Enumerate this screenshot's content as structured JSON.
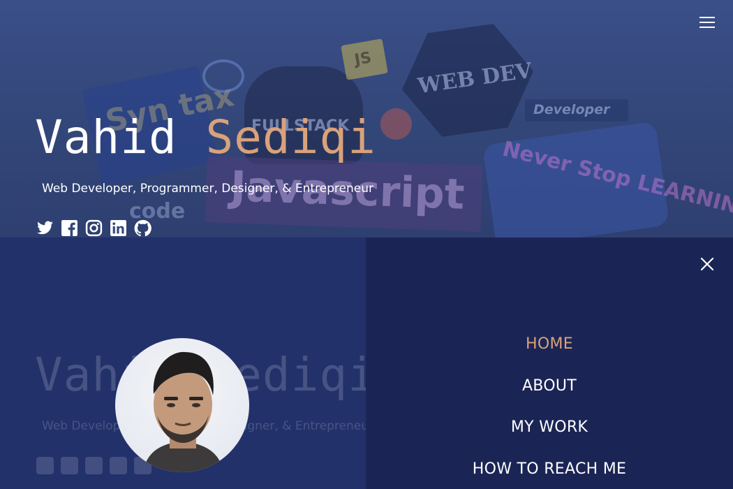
{
  "header": {
    "first_name": "Vahid",
    "last_name": "Sediqi",
    "tagline": "Web Developer, Programmer, Designer, & Entrepreneur"
  },
  "background_stickers": {
    "syntax": "Syn tax",
    "fullstack": "FULLSTACK",
    "web_dev": "WEB DEV",
    "js": "JS",
    "javascript": "Javascript",
    "developer": "Developer",
    "never_stop": "Never Stop LEARNING",
    "code": "code"
  },
  "social_links": [
    {
      "name": "twitter",
      "icon": "twitter-icon"
    },
    {
      "name": "facebook",
      "icon": "facebook-icon"
    },
    {
      "name": "instagram",
      "icon": "instagram-icon"
    },
    {
      "name": "linkedin",
      "icon": "linkedin-icon"
    },
    {
      "name": "github",
      "icon": "github-icon"
    }
  ],
  "menu": {
    "open_icon": "hamburger-menu-icon",
    "close_icon": "close-icon",
    "items": [
      {
        "label": "HOME",
        "active": true
      },
      {
        "label": "ABOUT",
        "active": false
      },
      {
        "label": "MY WORK",
        "active": false
      },
      {
        "label": "HOW TO REACH ME",
        "active": false
      }
    ]
  },
  "colors": {
    "accent": "#d9a27a",
    "overlay_left": "#22316a",
    "overlay_right": "#1b2555"
  }
}
